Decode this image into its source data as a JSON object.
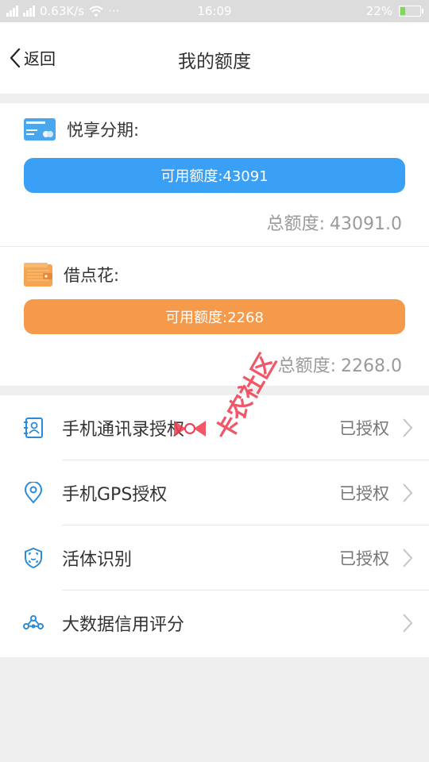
{
  "status_bar": {
    "speed": "0.63K/s",
    "time": "16:09",
    "battery": "22%",
    "dots": "···"
  },
  "header": {
    "back_label": "返回",
    "title": "我的额度"
  },
  "credits": [
    {
      "name": "悦享分期:",
      "available": "可用额度:43091",
      "total_label": "总额度:",
      "total_value": "43091.0",
      "color": "#3aa0f5"
    },
    {
      "name": "借点花:",
      "available": "可用额度:2268",
      "total_label": "总额度:",
      "total_value": "2268.0",
      "color": "#f5994a"
    }
  ],
  "auth_list": [
    {
      "label": "手机通讯录授权",
      "status": "已授权",
      "icon": "contacts-icon"
    },
    {
      "label": "手机GPS授权",
      "status": "已授权",
      "icon": "location-pin-icon"
    },
    {
      "label": "活体识别",
      "status": "已授权",
      "icon": "face-scan-icon"
    },
    {
      "label": "大数据信用评分",
      "status": "",
      "icon": "data-network-icon"
    }
  ],
  "watermark": "卡农社区",
  "colors": {
    "accent_blue": "#3aa0f5",
    "accent_orange": "#f5994a",
    "icon_blue": "#2b8bd8"
  }
}
